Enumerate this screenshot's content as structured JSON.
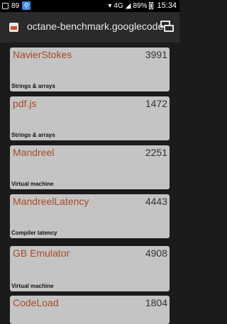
{
  "status_bar": {
    "indicator": "89",
    "network": "4G",
    "battery": "89%",
    "time": "15:34"
  },
  "app_bar": {
    "title": "octane-benchmark.googlecode"
  },
  "results": [
    {
      "name": "NavierStokes",
      "score": "3991",
      "category": "Strings & arrays"
    },
    {
      "name": "pdf.js",
      "score": "1472",
      "category": "Strings & arrays"
    },
    {
      "name": "Mandreel",
      "score": "2251",
      "category": "Virtual machine"
    },
    {
      "name": "MandreelLatency",
      "score": "4443",
      "category": "Compiler latency"
    },
    {
      "name": "GB Emulator",
      "score": "4908",
      "category": "Virtual machine"
    },
    {
      "name": "CodeLoad",
      "score": "1804",
      "category": ""
    }
  ],
  "colors": {
    "name_text": "#a84a28",
    "card_background": "#c4c4c4",
    "page_background": "#1b1b1b"
  }
}
